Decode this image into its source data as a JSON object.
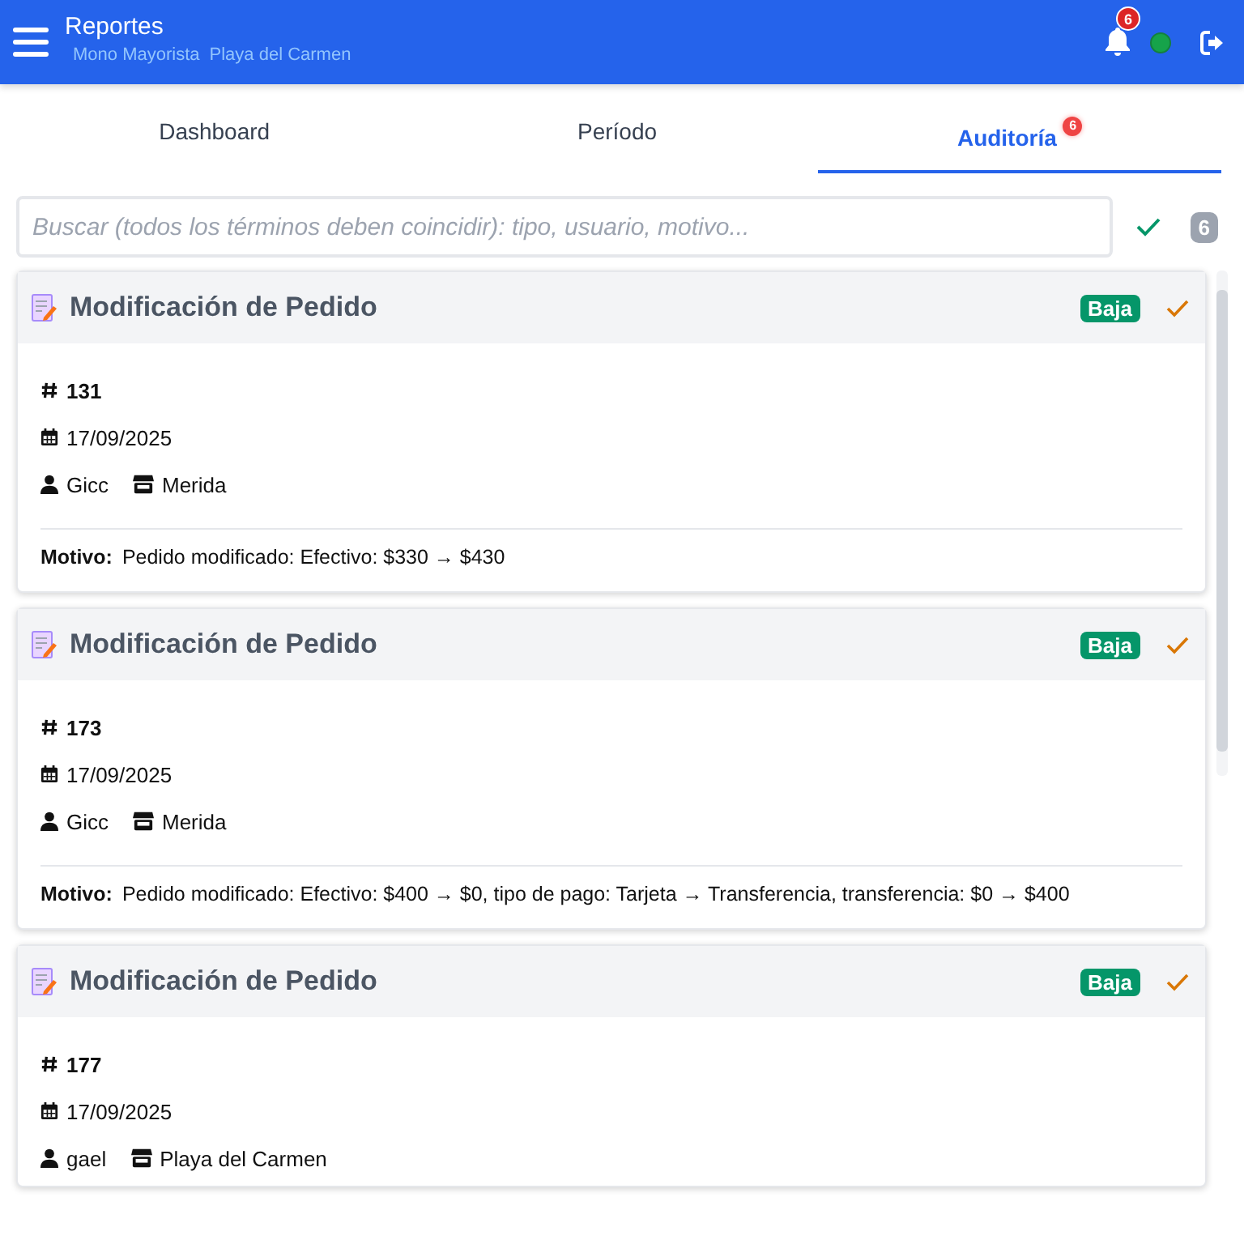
{
  "header": {
    "title": "Reportes",
    "subtitle": [
      "Mono Mayorista",
      "Playa del Carmen"
    ],
    "notifications": "6",
    "online": true
  },
  "tabs": [
    {
      "label": "Dashboard",
      "selected": false
    },
    {
      "label": "Período",
      "selected": false
    },
    {
      "label": "Auditoría",
      "selected": true,
      "badge": "6"
    }
  ],
  "search": {
    "placeholder": "Buscar (todos los términos deben coincidir): tipo, usuario, motivo...",
    "count": "6"
  },
  "records": [
    {
      "title": "Modificación de Pedido",
      "severity": "Baja",
      "number": "131",
      "date": "17/09/2025",
      "user": "Gicc",
      "store": "Merida",
      "reason_label": "Motivo:",
      "reason": "Pedido modificado: Efectivo: $330 → $430"
    },
    {
      "title": "Modificación de Pedido",
      "severity": "Baja",
      "number": "173",
      "date": "17/09/2025",
      "user": "Gicc",
      "store": "Merida",
      "reason_label": "Motivo:",
      "reason": "Pedido modificado: Efectivo: $400 → $0, tipo de pago: Tarjeta → Transferencia, transferencia: $0 → $400"
    },
    {
      "title": "Modificación de Pedido",
      "severity": "Baja",
      "number": "177",
      "date": "17/09/2025",
      "user": "gael",
      "store": "Playa del Carmen"
    }
  ]
}
